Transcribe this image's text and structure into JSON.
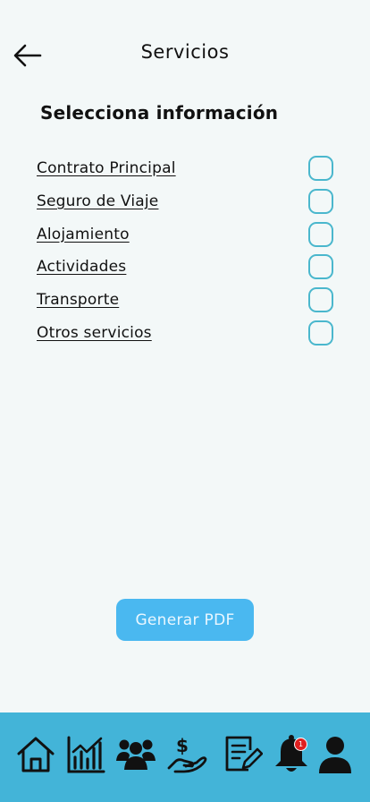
{
  "header": {
    "title": "Servicios",
    "back_icon": "arrow-left-icon"
  },
  "section": {
    "title": "Selecciona información"
  },
  "options": [
    {
      "label": "Contrato Principal",
      "checked": false
    },
    {
      "label": "Seguro de Viaje",
      "checked": false
    },
    {
      "label": "Alojamiento",
      "checked": false
    },
    {
      "label": "Actividades",
      "checked": false
    },
    {
      "label": "Transporte",
      "checked": false
    },
    {
      "label": "Otros servicios",
      "checked": false
    }
  ],
  "actions": {
    "generate_label": "Generar PDF"
  },
  "nav": {
    "items": [
      {
        "icon": "home-icon"
      },
      {
        "icon": "chart-icon"
      },
      {
        "icon": "group-icon"
      },
      {
        "icon": "payment-hand-icon"
      },
      {
        "icon": "document-edit-icon"
      },
      {
        "icon": "bell-icon",
        "badge": "1"
      },
      {
        "icon": "user-icon"
      }
    ]
  },
  "colors": {
    "background": "#f3f8f8",
    "accent": "#4ab7cd",
    "button": "#4ab8f0",
    "nav_bar": "#43b4d8",
    "badge": "#e02020"
  }
}
